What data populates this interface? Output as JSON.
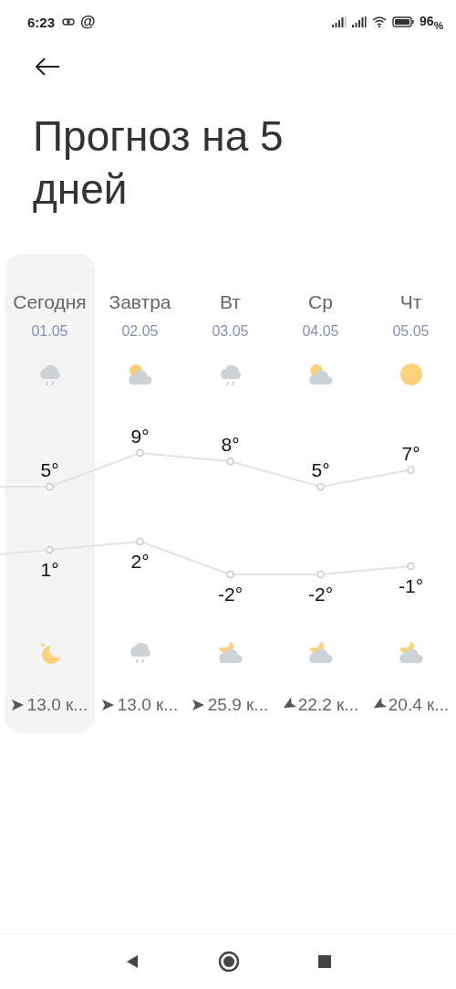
{
  "status_bar": {
    "time": "6:23",
    "at_sign": "@",
    "battery": "96$_{%}$"
  },
  "title": "Прогноз на 5 дней",
  "days": [
    {
      "label": "Сегодня",
      "date": "01.05",
      "selected": true,
      "day_icon": {
        "kind": "rain"
      },
      "high": "5°",
      "low": "1°",
      "night_icon": {
        "kind": "moon"
      },
      "wind_arrow": {
        "kind": "east"
      },
      "wind": "13.0 к..."
    },
    {
      "label": "Завтра",
      "date": "02.05",
      "selected": false,
      "day_icon": {
        "kind": "partly-cloudy"
      },
      "high": "9°",
      "low": "2°",
      "night_icon": {
        "kind": "rain"
      },
      "wind_arrow": {
        "kind": "east"
      },
      "wind": "13.0 к..."
    },
    {
      "label": "Вт",
      "date": "03.05",
      "selected": false,
      "day_icon": {
        "kind": "rain"
      },
      "high": "8°",
      "low": "-2°",
      "night_icon": {
        "kind": "night-cloudy"
      },
      "wind_arrow": {
        "kind": "east"
      },
      "wind": "25.9 к..."
    },
    {
      "label": "Ср",
      "date": "04.05",
      "selected": false,
      "day_icon": {
        "kind": "partly-cloudy"
      },
      "high": "5°",
      "low": "-2°",
      "night_icon": {
        "kind": "night-cloudy"
      },
      "wind_arrow": {
        "kind": "southwest"
      },
      "wind": "22.2 к..."
    },
    {
      "label": "Чт",
      "date": "05.05",
      "selected": false,
      "day_icon": {
        "kind": "sun"
      },
      "high": "7°",
      "low": "-1°",
      "night_icon": {
        "kind": "night-cloudy"
      },
      "wind_arrow": {
        "kind": "southwest"
      },
      "wind": "20.4 к..."
    }
  ]
}
